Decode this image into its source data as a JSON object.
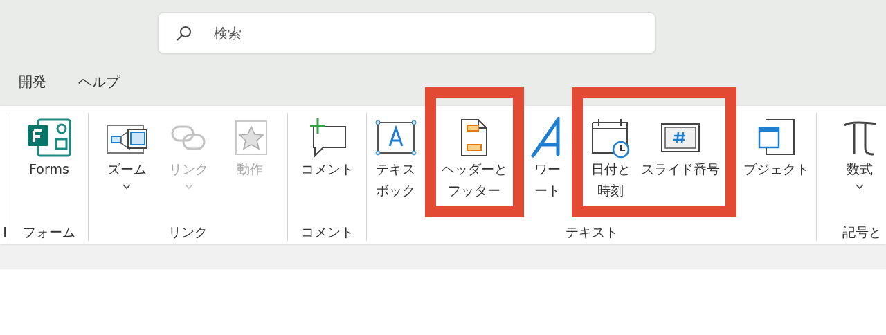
{
  "search": {
    "placeholder": "検索"
  },
  "tabs": [
    {
      "label": "開発"
    },
    {
      "label": "ヘルプ"
    }
  ],
  "ribbon": {
    "groups": [
      {
        "label": "I"
      },
      {
        "label": "フォーム",
        "buttons": [
          {
            "lines": [
              "Forms"
            ],
            "dropdown": false,
            "disabled": false,
            "framed": false
          }
        ]
      },
      {
        "label": "リンク",
        "buttons": [
          {
            "lines": [
              "ズーム"
            ],
            "dropdown": true,
            "disabled": false,
            "framed": false
          },
          {
            "lines": [
              "リンク"
            ],
            "dropdown": true,
            "disabled": true,
            "framed": false
          },
          {
            "lines": [
              "動作"
            ],
            "dropdown": false,
            "disabled": true,
            "framed": false
          }
        ]
      },
      {
        "label": "コメント",
        "buttons": [
          {
            "lines": [
              "コメント"
            ],
            "dropdown": false,
            "disabled": false,
            "framed": false
          }
        ]
      },
      {
        "label": "テキスト",
        "buttons": [
          {
            "lines": [
              "テキス",
              "ボック"
            ],
            "dropdown": false,
            "disabled": false,
            "framed": false
          },
          {
            "lines": [
              "ヘッダーと",
              "フッター"
            ],
            "dropdown": false,
            "disabled": false,
            "framed": true
          },
          {
            "lines": [
              "ワー",
              "ート"
            ],
            "dropdown": false,
            "disabled": false,
            "framed": false
          },
          {
            "lines": [
              "日付と",
              "時刻"
            ],
            "dropdown": false,
            "disabled": false,
            "framed": true
          },
          {
            "lines": [
              "スライド番号"
            ],
            "dropdown": false,
            "disabled": false,
            "framed": true
          },
          {
            "lines": [
              "ブジェクト"
            ],
            "dropdown": false,
            "disabled": false,
            "framed": false
          }
        ]
      },
      {
        "label": "記号と",
        "buttons": [
          {
            "lines": [
              "数式"
            ],
            "dropdown": true,
            "disabled": false,
            "framed": false
          }
        ]
      }
    ]
  }
}
